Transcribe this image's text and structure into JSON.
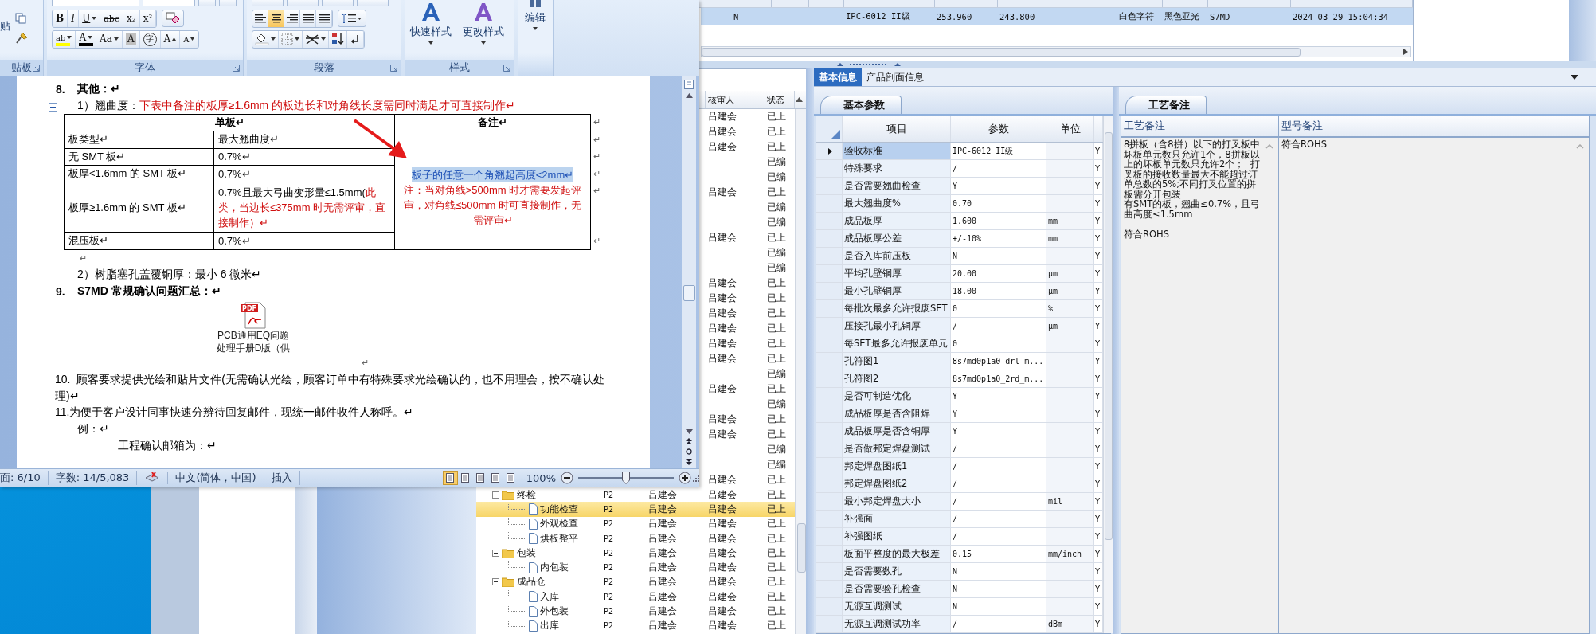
{
  "word": {
    "ribbon": {
      "clipboard": {
        "paste_label": "贴",
        "group_label": "贴板"
      },
      "font": {
        "row1": [
          {
            "label": "B",
            "dropdown": false
          },
          {
            "label": "I",
            "dropdown": false
          },
          {
            "label": "U",
            "dropdown": true
          },
          {
            "label": "abc",
            "dropdown": false
          },
          {
            "label": "x₂",
            "dropdown": false
          },
          {
            "label": "x²",
            "dropdown": false
          }
        ],
        "row2": [
          {
            "kind": "highlight",
            "label": "ab",
            "dropdown": true
          },
          {
            "kind": "font-color",
            "label": "A",
            "dropdown": true
          },
          {
            "kind": "case",
            "label": "Aa",
            "dropdown": true
          },
          {
            "kind": "shade",
            "label": "A",
            "dropdown": false
          },
          {
            "kind": "enclose",
            "label": "字",
            "dropdown": false
          },
          {
            "kind": "grow",
            "label": "A",
            "dropdown": false
          },
          {
            "kind": "shrink",
            "label": "A",
            "dropdown": false
          }
        ],
        "group_label": "字体"
      },
      "paragraph": {
        "align": [
          {
            "kind": "left",
            "selected": false
          },
          {
            "kind": "center",
            "selected": true
          },
          {
            "kind": "right",
            "selected": false
          },
          {
            "kind": "justify",
            "selected": false
          },
          {
            "kind": "distribute",
            "selected": false
          }
        ],
        "row2": [
          {
            "kind": "shading",
            "dropdown": true
          },
          {
            "kind": "borders",
            "dropdown": true
          },
          {
            "kind": "asian-layout",
            "dropdown": true
          },
          {
            "kind": "sort",
            "dropdown": false
          },
          {
            "kind": "marks",
            "dropdown": false
          }
        ],
        "group_label": "段落"
      },
      "styles": {
        "buttons": [
          {
            "label": "快速样式"
          },
          {
            "label": "更改样式"
          }
        ],
        "group_label": "样式"
      },
      "edit": {
        "label": "编辑"
      }
    },
    "document": {
      "heading_8": {
        "number": "8.",
        "text": "其他：↵"
      },
      "item_1": {
        "text": "1）翘曲度：",
        "red": "下表中备注的板厚≥1.6mm 的板边长和对角线长度需同时满足才可直接制作↵"
      },
      "table": {
        "header": [
          {
            "text": "单板↵"
          },
          {
            "text": "备注↵"
          }
        ],
        "rows": [
          {
            "cells": [
              {
                "text": "板类型↵"
              },
              {
                "text": "最大翘曲度↵"
              }
            ]
          },
          {
            "cells": [
              {
                "text": "无 SMT 板↵"
              },
              {
                "text": "0.7%↵"
              }
            ]
          },
          {
            "cells": [
              {
                "text": "板厚<1.6mm 的 SMT 板↵"
              },
              {
                "text": "0.7%↵"
              }
            ]
          },
          {
            "cells": [
              {
                "text": "板厚≥1.6mm 的 SMT 板↵"
              },
              {
                "text": "0.7%且最大弓曲变形量≤1.5mm(",
                "red": "此类，当边长≤375mm 时无需评审，直接制作）↵"
              }
            ]
          },
          {
            "cells": [
              {
                "text": "混压板↵"
              },
              {
                "text": "0.7%↵"
              }
            ]
          }
        ],
        "note_highlight": "板子的任意一个角翘起高度<2mm↵",
        "note_red": "注：当对角线>500mm 时才需要发起评审，对角线≤500mm 时可直接制作，无需评审↵",
        "row_marks": [
          "↵",
          "↵",
          "↵",
          "↵",
          "↵",
          "↵"
        ]
      },
      "blank_1": "↵",
      "item_2": {
        "text": "2）树脂塞孔盖覆铜厚：最小 6 微米↵"
      },
      "heading_9": {
        "number": "9.",
        "text": "S7MD 常规确认问题汇总：↵"
      },
      "attachment": {
        "badge": "PDF",
        "lines": [
          "PCB通用EQ问题",
          "处理手册D版（供"
        ]
      },
      "blank_2": "↵",
      "item_10": {
        "number": "10.",
        "text": "顾客要求提供光绘和贴片文件(无需确认光绘，顾客订单中有特殊要求光绘确认的，也不用理会，按不确认处理)↵"
      },
      "item_11": {
        "number": "11.",
        "text": "为便于客户设计同事快速分辨待回复邮件，现统一邮件收件人称呼。↵"
      },
      "example": "例：↵",
      "mailbox": "工程确认邮箱为：↵"
    },
    "status_bar": {
      "page": "面: 6/10",
      "words": "字数: 14/5,083",
      "language": "中文(简体，中国)",
      "mode": "插入",
      "views": [
        {
          "selected": true
        },
        {
          "selected": false
        },
        {
          "selected": false
        },
        {
          "selected": false
        },
        {
          "selected": false
        }
      ],
      "zoom": "100%",
      "zoom_level": {
        "level": 0.5
      }
    }
  },
  "top_grid": {
    "row": {
      "selected": true,
      "cells": [
        "N",
        "IPC-6012 II级",
        "253.960",
        "243.800",
        "白色字符",
        "黑色亚光",
        "S7MD",
        "2024-03-29 15:04:34"
      ]
    }
  },
  "review_list": {
    "columns": [
      {
        "label": "核审人"
      },
      {
        "label": "状态"
      }
    ],
    "rows": [
      {
        "reviewer": "吕建会",
        "status": "已上",
        "selected": false
      },
      {
        "reviewer": "吕建会",
        "status": "已上",
        "selected": false
      },
      {
        "reviewer": "吕建会",
        "status": "已上",
        "selected": false
      },
      {
        "status": "已编",
        "selected": false
      },
      {
        "status": "已编",
        "selected": false
      },
      {
        "reviewer": "吕建会",
        "status": "已上",
        "selected": false
      },
      {
        "status": "已编",
        "selected": false
      },
      {
        "status": "已编",
        "selected": false
      },
      {
        "reviewer": "吕建会",
        "status": "已上",
        "selected": false
      },
      {
        "status": "已编",
        "selected": false
      },
      {
        "status": "已编",
        "selected": false
      },
      {
        "reviewer": "吕建会",
        "status": "已上",
        "selected": false
      },
      {
        "reviewer": "吕建会",
        "status": "已上",
        "selected": false
      },
      {
        "reviewer": "吕建会",
        "status": "已上",
        "selected": false
      },
      {
        "reviewer": "吕建会",
        "status": "已上",
        "selected": false
      },
      {
        "reviewer": "吕建会",
        "status": "已上",
        "selected": false
      },
      {
        "reviewer": "吕建会",
        "status": "已上",
        "selected": false
      },
      {
        "status": "已编",
        "selected": false
      },
      {
        "reviewer": "吕建会",
        "status": "已上",
        "selected": false
      },
      {
        "status": "已编",
        "selected": false
      },
      {
        "reviewer": "吕建会",
        "status": "已上",
        "selected": false
      },
      {
        "reviewer": "吕建会",
        "status": "已上",
        "selected": false
      },
      {
        "status": "已编",
        "selected": false
      },
      {
        "status": "已编",
        "selected": false
      },
      {
        "reviewer": "吕建会",
        "status": "已上",
        "selected": false
      }
    ],
    "tree": [
      {
        "name": "终检",
        "column_2": "P2",
        "column_3": "吕建会",
        "reviewer": "吕建会",
        "status": "已上",
        "expanded": true,
        "selected": false,
        "children": [
          {
            "name": "功能检查",
            "column_2": "P2",
            "column_3": "吕建会",
            "reviewer": "吕建会",
            "status": "已上",
            "selected": true
          },
          {
            "name": "外观检查",
            "column_2": "P2",
            "column_3": "吕建会",
            "reviewer": "吕建会",
            "status": "已上",
            "selected": false
          },
          {
            "name": "烘板整平",
            "column_2": "P2",
            "column_3": "吕建会",
            "reviewer": "吕建会",
            "status": "已上",
            "selected": false
          }
        ]
      },
      {
        "name": "包装",
        "column_2": "P2",
        "column_3": "吕建会",
        "reviewer": "吕建会",
        "status": "已上",
        "expanded": true,
        "selected": false,
        "children": [
          {
            "name": "内包装",
            "column_2": "P2",
            "column_3": "吕建会",
            "reviewer": "吕建会",
            "status": "已上",
            "selected": false
          }
        ]
      },
      {
        "name": "成品仓",
        "column_2": "P2",
        "column_3": "吕建会",
        "reviewer": "吕建会",
        "status": "已上",
        "expanded": true,
        "selected": false,
        "children": [
          {
            "name": "入库",
            "column_2": "P2",
            "column_3": "吕建会",
            "reviewer": "吕建会",
            "status": "已上",
            "selected": false
          },
          {
            "name": "外包装",
            "column_2": "P2",
            "column_3": "吕建会",
            "reviewer": "吕建会",
            "status": "已上",
            "selected": false
          },
          {
            "name": "出库",
            "column_2": "P2",
            "column_3": "吕建会",
            "reviewer": "吕建会",
            "status": "已上",
            "selected": false
          }
        ]
      }
    ]
  },
  "tabs": [
    {
      "label": "基本信息",
      "selected": true
    },
    {
      "label": "产品剖面信息",
      "selected": false
    }
  ],
  "parameters": {
    "tab": "基本参数",
    "columns": [
      {
        "label": "项目"
      },
      {
        "label": "参数"
      },
      {
        "label": "单位"
      }
    ],
    "rows": [
      {
        "item": "验收标准",
        "value": "IPC-6012 II级",
        "flag": "Y",
        "selected": true
      },
      {
        "item": "特殊要求",
        "value": "/",
        "flag": "Y",
        "selected": false
      },
      {
        "item": "是否需要翘曲检查",
        "value": "Y",
        "flag": "Y",
        "selected": false
      },
      {
        "item": "最大翘曲度%",
        "value": "0.70",
        "flag": "Y",
        "selected": false
      },
      {
        "item": "成品板厚",
        "value": "1.600",
        "unit": "mm",
        "flag": "Y",
        "selected": false
      },
      {
        "item": "成品板厚公差",
        "value": "+/-10%",
        "unit": "mm",
        "flag": "Y",
        "selected": false
      },
      {
        "item": "是否入库前压板",
        "value": "N",
        "flag": "Y",
        "selected": false
      },
      {
        "item": "平均孔壁铜厚",
        "value": "20.00",
        "unit": "μm",
        "flag": "Y",
        "selected": false
      },
      {
        "item": "最小孔壁铜厚",
        "value": "18.00",
        "unit": "μm",
        "flag": "Y",
        "selected": false
      },
      {
        "item": "每批次最多允许报废SET",
        "value": "0",
        "unit": "%",
        "flag": "Y",
        "selected": false
      },
      {
        "item": "压接孔最小孔铜厚",
        "value": "/",
        "unit": "μm",
        "flag": "Y",
        "selected": false
      },
      {
        "item": "每SET最多允许报废单元",
        "value": "0",
        "flag": "Y",
        "selected": false
      },
      {
        "item": "孔符图1",
        "value": "8s7md0p1a0_drl_m...",
        "flag": "Y",
        "selected": false
      },
      {
        "item": "孔符图2",
        "value": "8s7md0p1a0_2rd_m...",
        "flag": "Y",
        "selected": false
      },
      {
        "item": "是否可制造优化",
        "value": "Y",
        "flag": "Y",
        "selected": false
      },
      {
        "item": "成品板厚是否含阻焊",
        "value": "Y",
        "flag": "Y",
        "selected": false
      },
      {
        "item": "成品板厚是否含铜厚",
        "value": "Y",
        "flag": "Y",
        "selected": false
      },
      {
        "item": "是否做邦定焊盘测试",
        "value": "/",
        "flag": "Y",
        "selected": false
      },
      {
        "item": "邦定焊盘图纸1",
        "value": "/",
        "flag": "Y",
        "selected": false
      },
      {
        "item": "邦定焊盘图纸2",
        "value": "/",
        "flag": "Y",
        "selected": false
      },
      {
        "item": "最小邦定焊盘大小",
        "value": "/",
        "unit": "mil",
        "flag": "Y",
        "selected": false
      },
      {
        "item": "补强面",
        "value": "/",
        "flag": "Y",
        "selected": false
      },
      {
        "item": "补强图纸",
        "value": "/",
        "flag": "Y",
        "selected": false
      },
      {
        "item": "板面平整度的最大极差",
        "value": "0.15",
        "unit": "mm/inch",
        "flag": "Y",
        "selected": false
      },
      {
        "item": "是否需要数孔",
        "value": "N",
        "flag": "Y",
        "selected": false
      },
      {
        "item": "是否需要验孔检查",
        "value": "N",
        "flag": "Y",
        "selected": false
      },
      {
        "item": "无源互调测试",
        "value": "N",
        "flag": "Y",
        "selected": false
      },
      {
        "item": "无源互调测试功率",
        "value": "/",
        "unit": "dBm",
        "flag": "Y",
        "selected": false
      }
    ]
  },
  "notes": {
    "tab": "工艺备注",
    "columns": [
      {
        "label": "工艺备注"
      },
      {
        "label": "型号备注"
      }
    ],
    "process_note": [
      "8拼板（含8拼）以下的打叉板中坏板单元数只允许1个，8拼板以上的坏板单元数只允许2个；  打叉板的接收数量最大不能超过订单总数的5%;不同打叉位置的拼板需分开包装",
      "有SMT的板，翘曲≤0.7%，且弓曲高度≤1.5mm",
      "符合ROHS"
    ],
    "model_note": "符合ROHS"
  }
}
